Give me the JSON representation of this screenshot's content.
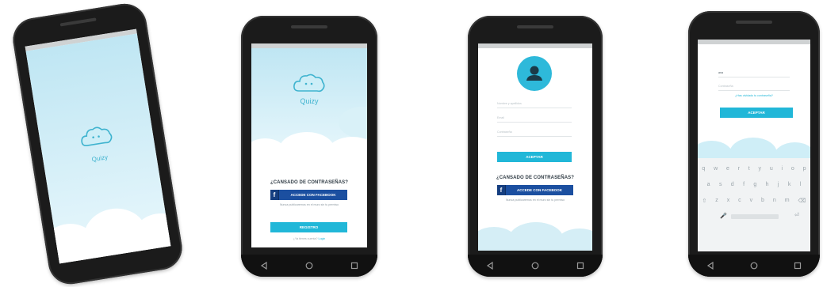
{
  "colors": {
    "accent": "#21b7d8",
    "facebook": "#1b4fa0",
    "phone": "#1b1b1b",
    "sky": "#bfe6f3"
  },
  "splash": {
    "brand": "Quizy"
  },
  "welcome": {
    "brand": "Quizy",
    "headline": "¿CANSADO DE CONTRASEÑAS?",
    "facebook_button": "ACCEDE CON FACEBOOK",
    "disclaimer": "Nunca publicaremos en el muro sin tu permiso",
    "register_button": "REGISTRO",
    "login_prompt": "¿Ya tienes cuenta?",
    "login_link": "Login"
  },
  "register": {
    "avatar_icon": "person-icon",
    "fields": [
      "Nombre y apellidos",
      "Email",
      "Contraseña"
    ],
    "accept_button": "ACEPTAR",
    "headline": "¿CANSADO DE CONTRASEÑAS?",
    "facebook_button": "ACCEDE CON FACEBOOK",
    "disclaimer": "Nunca publicaremos en el muro sin tu permiso"
  },
  "login": {
    "email_value": "ana",
    "password_placeholder": "Contraseña",
    "forgot_link": "¿Has olvidado tu contraseña?",
    "accept_button": "ACEPTAR",
    "keyboard_row1": [
      "q",
      "w",
      "e",
      "r",
      "t",
      "y",
      "u",
      "i",
      "o",
      "p"
    ],
    "keyboard_row2": [
      "a",
      "s",
      "d",
      "f",
      "g",
      "h",
      "j",
      "k",
      "l"
    ],
    "keyboard_row3": [
      "z",
      "x",
      "c",
      "v",
      "b",
      "n",
      "m"
    ]
  },
  "nav": {
    "back_icon": "back-triangle-icon",
    "home_icon": "home-circle-icon",
    "recents_icon": "recents-square-icon"
  }
}
